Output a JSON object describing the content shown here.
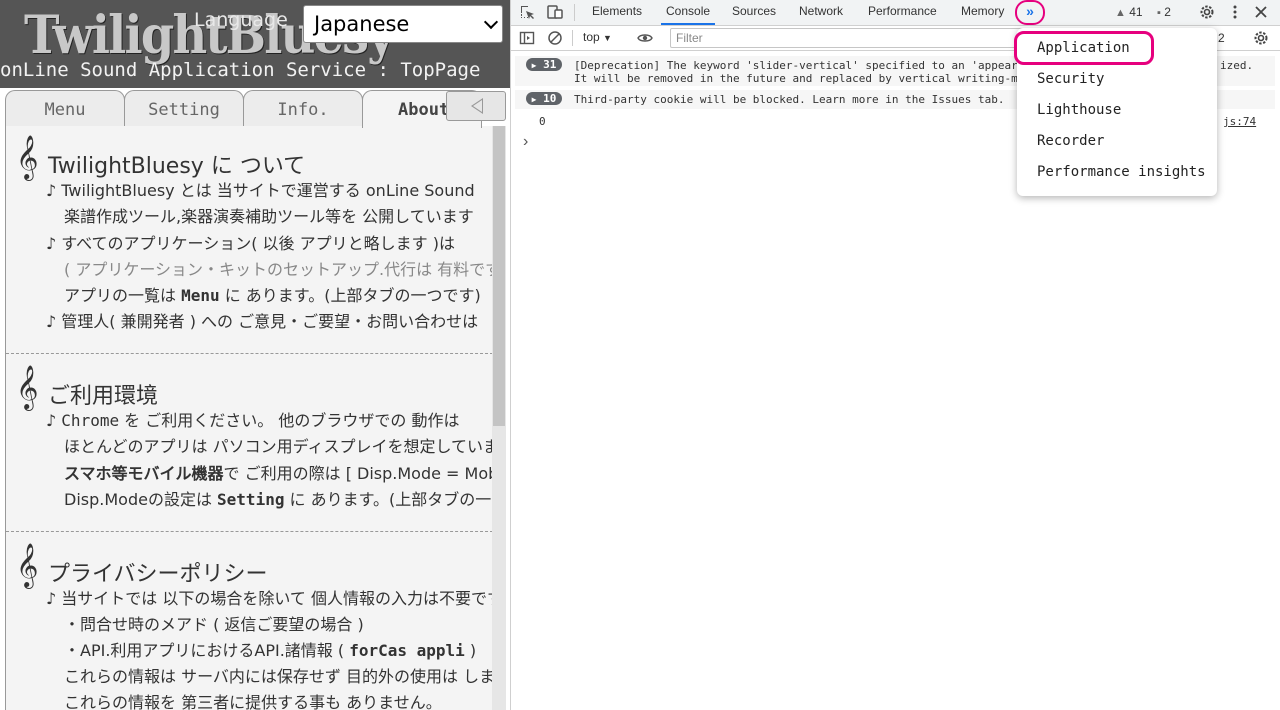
{
  "site": {
    "logo_text": "TwilightBluesy",
    "language_label": "Language",
    "language_value": "Japanese",
    "subtitle": "onLine Sound Application Service : TopPage",
    "tabs": [
      {
        "label": "Menu"
      },
      {
        "label": "Setting"
      },
      {
        "label": "Info."
      },
      {
        "label": "About"
      }
    ],
    "sections": [
      {
        "title": "TwilightBluesy に ついて",
        "lines": [
          {
            "t": "♪ TwilightBluesy とは 当サイトで運営する onLine Sound"
          },
          {
            "t": "楽譜作成ツール,楽器演奏補助ツール等を 公開しています"
          },
          {
            "t": "♪ すべてのアプリケーション( 以後 アプリと略します )は"
          },
          {
            "t": "( アプリケーション・キットのセットアップ.代行は 有料です )"
          },
          {
            "a": "アプリの一覧は ",
            "b": "Menu",
            "c": " に あります。(上部タブの一つです)"
          },
          {
            "t": "♪ 管理人( 兼開発者 ) への ご意見・ご要望・お問い合わせは"
          }
        ]
      },
      {
        "title": "ご利用環境",
        "lines": [
          {
            "a": "♪ ",
            "b": "Chrome",
            "c": " を ご利用ください。 他のブラウザでの 動作は"
          },
          {
            "t": "ほとんどのアプリは パソコン用ディスプレイを想定しています"
          },
          {
            "b": "スマホ等モバイル機器",
            "c": "で ご利用の際は [ Disp.Mode = Mobile ]"
          },
          {
            "a": "Disp.Modeの設定は ",
            "b": "Setting",
            "c": " に あります。(上部タブの一つです)"
          }
        ]
      },
      {
        "title": "プライバシーポリシー",
        "lines": [
          {
            "t": "♪ 当サイトでは 以下の場合を除いて 個人情報の入力は不要です"
          },
          {
            "t": "・問合せ時のメアド ( 返信ご要望の場合 )"
          },
          {
            "a": "・API.利用アプリにおけるAPI.諸情報 ( ",
            "b": "forCas appli",
            "c": " )"
          },
          {
            "t": "これらの情報は サーバ内には保存せず 目的外の使用は しません"
          },
          {
            "t": "これらの情報を 第三者に提供する事も ありません。"
          }
        ]
      }
    ]
  },
  "devtools": {
    "tabs": [
      "Elements",
      "Console",
      "Sources",
      "Network",
      "Performance",
      "Memory"
    ],
    "active_tab": "Console",
    "more_tabs_glyph": "»",
    "warnings_count": "41",
    "issues_count": "2",
    "context": "top",
    "filter_placeholder": "Filter",
    "toolbar_issues_count": "2",
    "messages": [
      {
        "count": "31",
        "text1": "[Deprecation] The keyword 'slider-vertical' specified to an 'appear",
        "text1_tail": "ized.",
        "text2": "It will be removed in the future and replaced by vertical writing-m"
      },
      {
        "count": "10",
        "text1": "Third-party cookie will be blocked. Learn more in the Issues tab."
      }
    ],
    "log_value": "0",
    "source_link": "js:74",
    "prompt": "›",
    "more_menu": [
      "Application",
      "Security",
      "Lighthouse",
      "Recorder",
      "Performance insights"
    ],
    "highlight_color": "#e6007e",
    "accent_color": "#1a73e8"
  }
}
